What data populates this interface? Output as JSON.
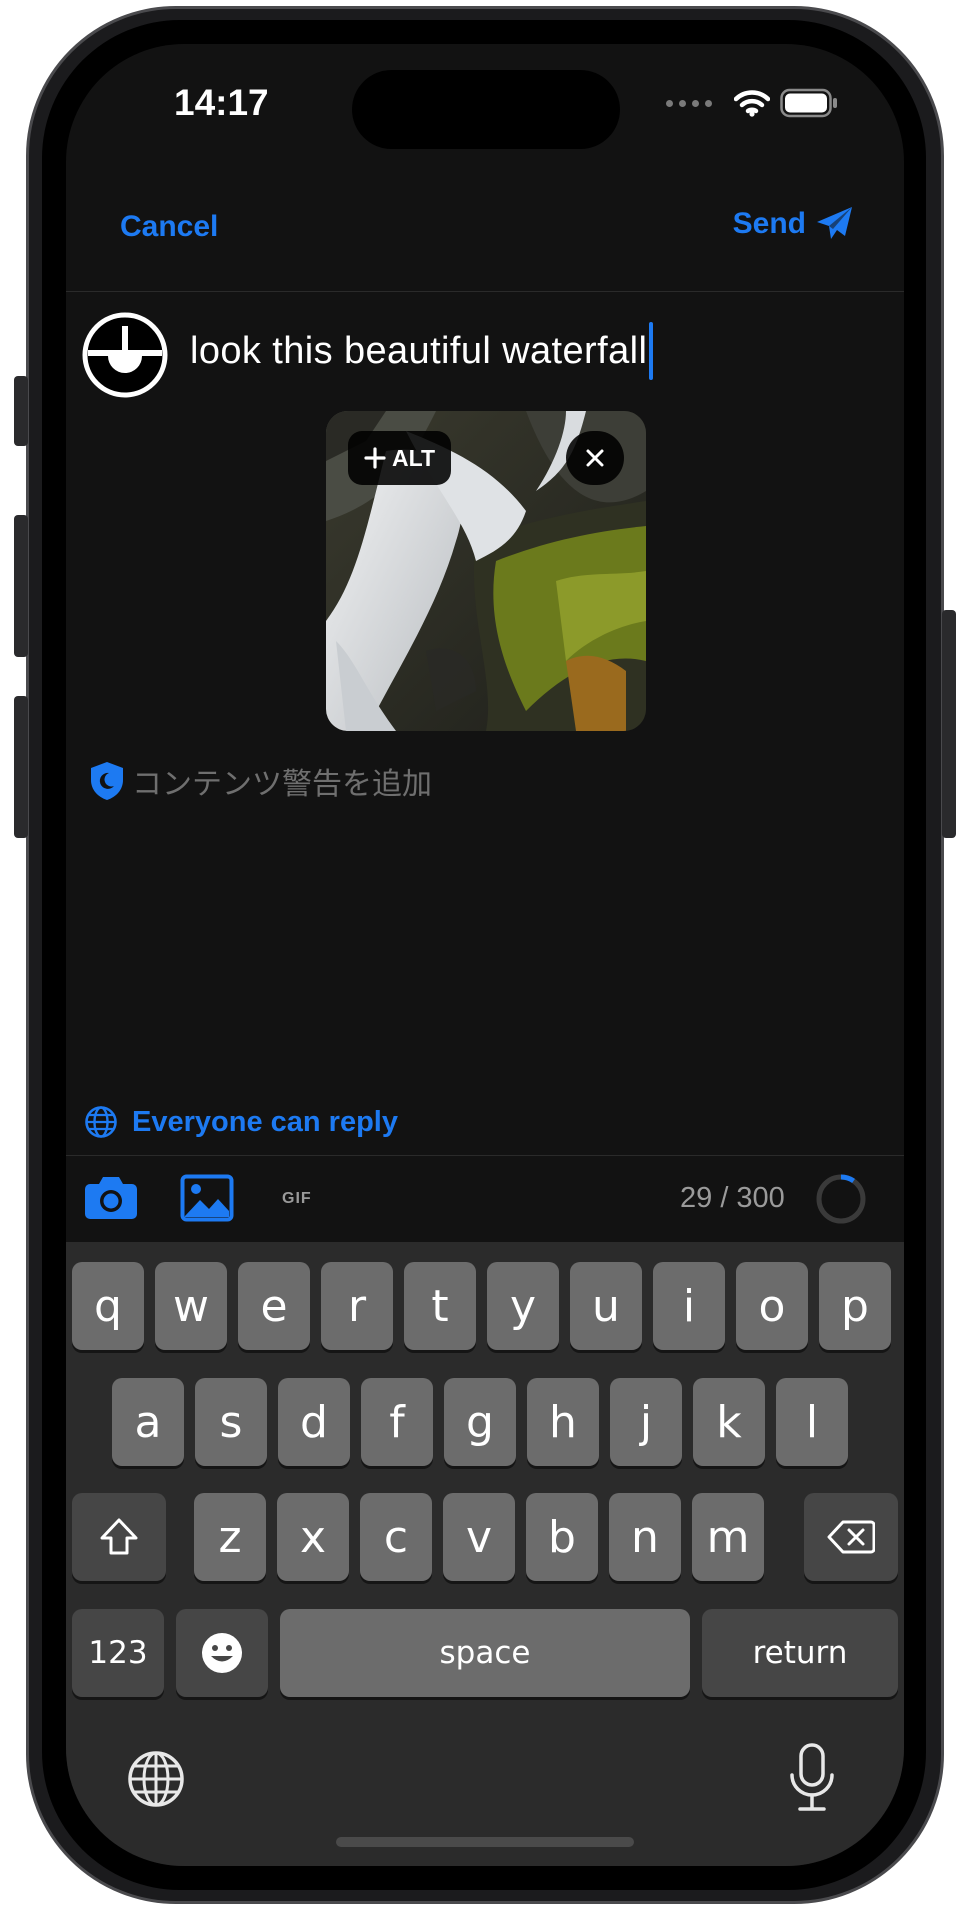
{
  "status_bar": {
    "time": "14:17"
  },
  "nav": {
    "cancel_label": "Cancel",
    "send_label": "Send"
  },
  "compose": {
    "text": "look this beautiful waterfall"
  },
  "media": {
    "alt_label": "ALT"
  },
  "content_warning": {
    "label": "コンテンツ警告を追加"
  },
  "reply_setting": {
    "label": "Everyone can reply"
  },
  "toolbar": {
    "gif_label": "GIF",
    "char_count": "29 / 300",
    "char_used": 29,
    "char_max": 300
  },
  "keyboard": {
    "row1": [
      "q",
      "w",
      "e",
      "r",
      "t",
      "y",
      "u",
      "i",
      "o",
      "p"
    ],
    "row2": [
      "a",
      "s",
      "d",
      "f",
      "g",
      "h",
      "j",
      "k",
      "l"
    ],
    "row3": [
      "z",
      "x",
      "c",
      "v",
      "b",
      "n",
      "m"
    ],
    "numbers_label": "123",
    "space_label": "space",
    "return_label": "return"
  },
  "colors": {
    "accent": "#1d7af2",
    "background": "#121212",
    "keyboard": "#2b2b2b"
  }
}
